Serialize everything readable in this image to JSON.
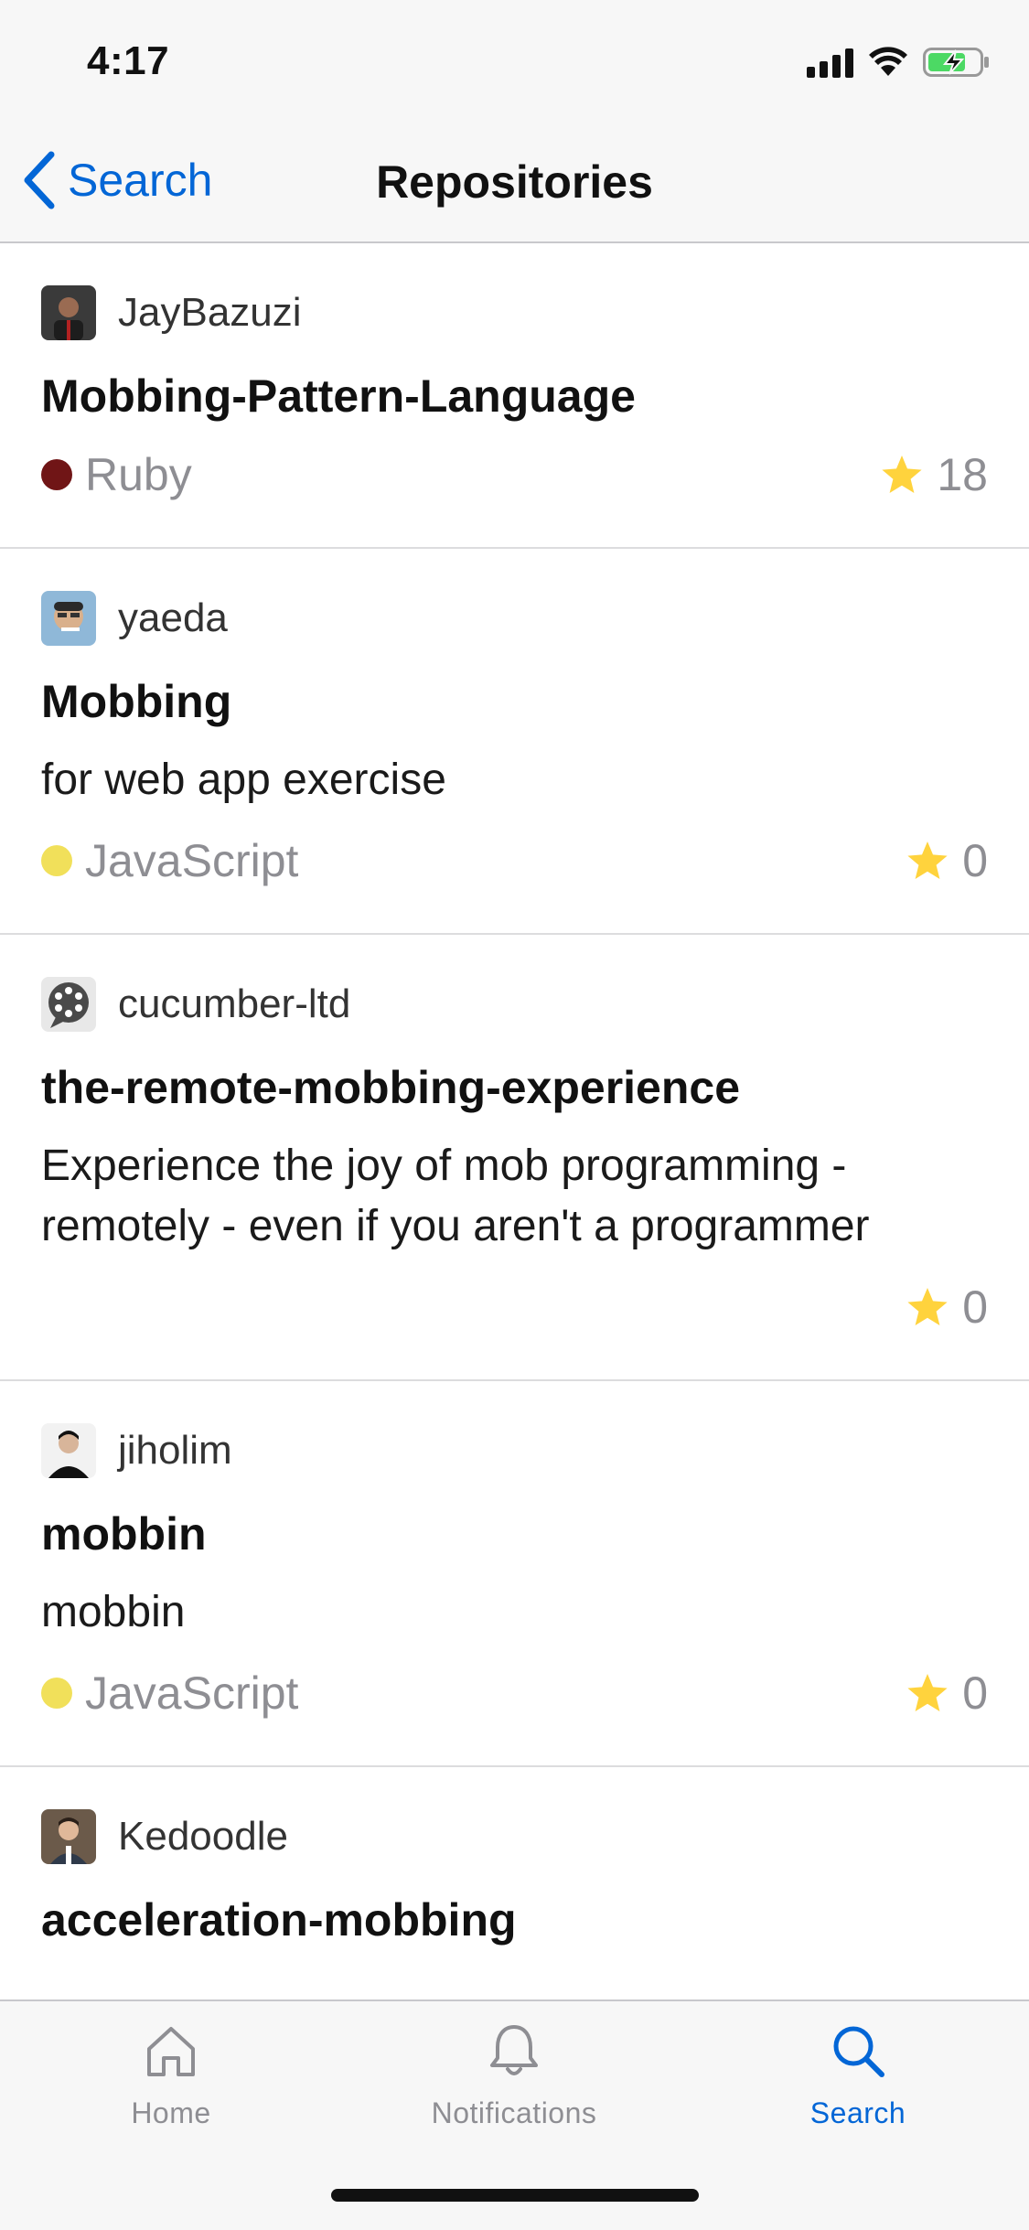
{
  "status_bar": {
    "time": "4:17",
    "icons": [
      "cellular-signal-icon",
      "wifi-icon",
      "battery-charging-icon"
    ]
  },
  "nav": {
    "back_label": "Search",
    "title": "Repositories"
  },
  "colors": {
    "accent": "#0366d6",
    "ruby": "#701516",
    "javascript": "#f1e05a",
    "star": "#ffd33d",
    "muted": "#8e8e93"
  },
  "repositories": [
    {
      "owner": "JayBazuzi",
      "name": "Mobbing-Pattern-Language",
      "description": "",
      "language": "Ruby",
      "language_color": "#701516",
      "stars": "18"
    },
    {
      "owner": "yaeda",
      "name": "Mobbing",
      "description": "for web app exercise",
      "language": "JavaScript",
      "language_color": "#f1e05a",
      "stars": "0"
    },
    {
      "owner": "cucumber-ltd",
      "name": "the-remote-mobbing-experience",
      "description": "Experience the joy of mob programming - remotely - even if you aren't a programmer",
      "language": "",
      "language_color": "",
      "stars": "0"
    },
    {
      "owner": "jiholim",
      "name": "mobbin",
      "description": "mobbin",
      "language": "JavaScript",
      "language_color": "#f1e05a",
      "stars": "0"
    },
    {
      "owner": "Kedoodle",
      "name": "acceleration-mobbing",
      "description": "",
      "language": "",
      "language_color": "",
      "stars": ""
    }
  ],
  "tabs": [
    {
      "label": "Home",
      "icon": "home-icon",
      "active": false
    },
    {
      "label": "Notifications",
      "icon": "bell-icon",
      "active": false
    },
    {
      "label": "Search",
      "icon": "search-icon",
      "active": true
    }
  ]
}
